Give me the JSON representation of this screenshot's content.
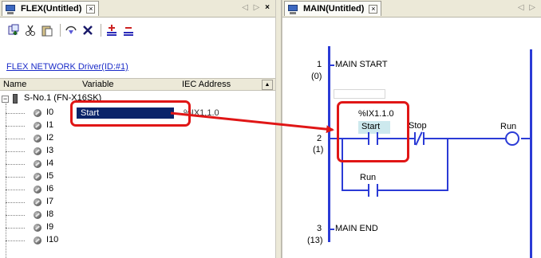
{
  "left_panel": {
    "tab_title": "FLEX(Untitled)",
    "tab_close": "×",
    "nav_arrows": "◁ ▷",
    "close": "×",
    "toolbar_icons": [
      "add-station-icon",
      "cut-icon",
      "paste-icon",
      "copy-icon",
      "delete-icon",
      "add-all-icon",
      "remove-all-icon"
    ],
    "driver_link": "FLEX NETWORK Driver(ID:#1)",
    "columns": {
      "name": "Name",
      "variable": "Variable",
      "iec": "IEC Address"
    },
    "station": {
      "expander": "⊟",
      "label": "S-No.1 (FN-X16SK)"
    },
    "rows": [
      {
        "name": "I0",
        "variable": "Start",
        "iec": "%IX1.1.0"
      },
      {
        "name": "I1"
      },
      {
        "name": "I2"
      },
      {
        "name": "I3"
      },
      {
        "name": "I4"
      },
      {
        "name": "I5"
      },
      {
        "name": "I6"
      },
      {
        "name": "I7"
      },
      {
        "name": "I8"
      },
      {
        "name": "I9"
      },
      {
        "name": "I10"
      }
    ]
  },
  "right_panel": {
    "tab_title": "MAIN(Untitled)",
    "tab_close": "×",
    "nav_arrows": "◁ ▷",
    "rungs": [
      {
        "number": "1",
        "step": "(0)",
        "label": "MAIN START"
      },
      {
        "number": "2",
        "step": "(1)"
      },
      {
        "number": "3",
        "step": "(13)",
        "label": "MAIN END"
      }
    ],
    "instructions": {
      "start_address": "%IX1.1.0",
      "start_label": "Start",
      "stop_label": "Stop",
      "run_coil_label": "Run",
      "run_contact_label": "Run"
    }
  },
  "colors": {
    "highlight_box": "#e01616",
    "ladder_line": "#2b3bd6",
    "selection": "#0a246a"
  }
}
